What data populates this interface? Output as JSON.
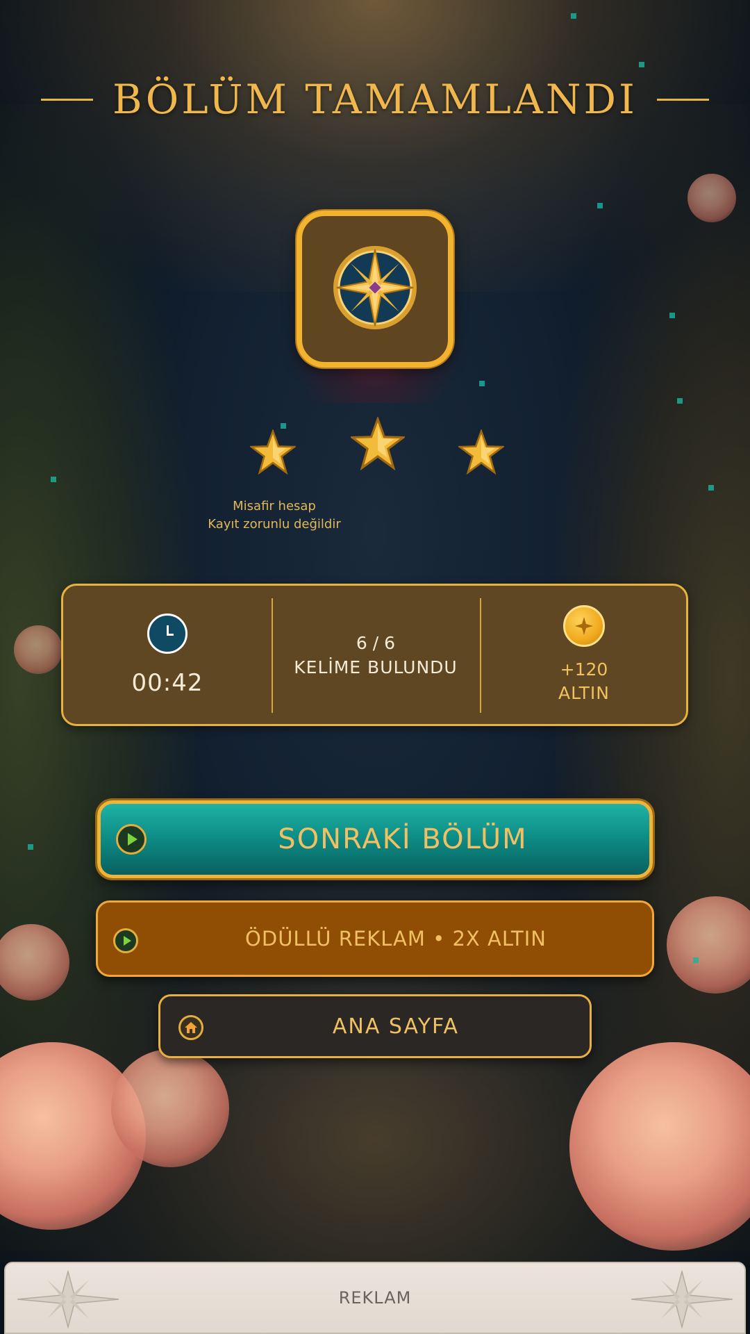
{
  "title": "BÖLÜM TAMAMLANDI",
  "badge": {
    "icon": "compass-emblem-icon"
  },
  "stars": {
    "earned": 3,
    "total": 3
  },
  "account": {
    "line1": "Misafir hesap",
    "line2": "Kayıt zorunlu değildir"
  },
  "stats": {
    "time": {
      "icon": "clock-icon",
      "value": "00:42"
    },
    "words": {
      "count": "6 / 6",
      "label": "KELİME BULUNDU"
    },
    "gold": {
      "icon": "gold-coin-icon",
      "amount": "+120",
      "label": "ALTIN"
    }
  },
  "buttons": {
    "next_level": {
      "label": "SONRAKİ BÖLÜM",
      "icon": "play-icon"
    },
    "rewarded_ad": {
      "label": "ÖDÜLLÜ REKLAM • 2X ALTIN",
      "icon": "play-icon"
    },
    "home": {
      "label": "ANA SAYFA",
      "icon": "home-icon"
    }
  },
  "ad_banner": {
    "label": "REKLAM"
  },
  "colors": {
    "gold": "#f0b84c",
    "panel": "#5e4722",
    "teal_button": "#0e8e88",
    "orange_button": "#8f4e04",
    "dark_button": "#2a2724"
  }
}
